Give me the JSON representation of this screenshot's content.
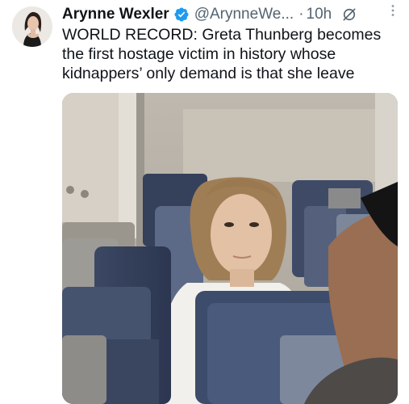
{
  "author": {
    "display_name": "Arynne Wexler",
    "handle": "@ArynneWe...",
    "separator": "·",
    "timestamp": "10h",
    "verified": true
  },
  "tweet": {
    "text": "WORLD RECORD: Greta Thunberg becomes the first hostage victim in history whose kidnappers’ only demand is that she leave"
  },
  "icons": {
    "verified": "verified-badge-icon",
    "grok": "grok-icon",
    "more": "more-options-icon"
  },
  "colors": {
    "verified_blue": "#1d9bf0",
    "secondary_text": "#536471",
    "primary_text": "#0f1419"
  }
}
